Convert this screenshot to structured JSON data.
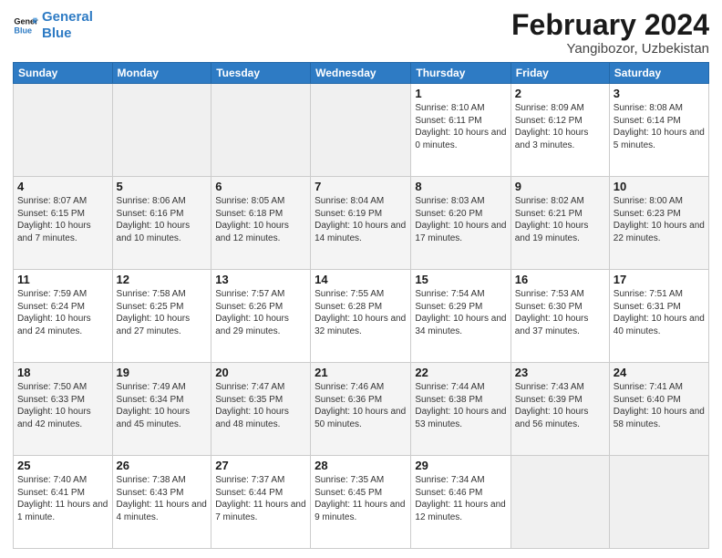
{
  "logo": {
    "line1": "General",
    "line2": "Blue"
  },
  "title": "February 2024",
  "subtitle": "Yangibozor, Uzbekistan",
  "days_header": [
    "Sunday",
    "Monday",
    "Tuesday",
    "Wednesday",
    "Thursday",
    "Friday",
    "Saturday"
  ],
  "weeks": [
    [
      {
        "day": "",
        "info": ""
      },
      {
        "day": "",
        "info": ""
      },
      {
        "day": "",
        "info": ""
      },
      {
        "day": "",
        "info": ""
      },
      {
        "day": "1",
        "info": "Sunrise: 8:10 AM\nSunset: 6:11 PM\nDaylight: 10 hours and 0 minutes."
      },
      {
        "day": "2",
        "info": "Sunrise: 8:09 AM\nSunset: 6:12 PM\nDaylight: 10 hours and 3 minutes."
      },
      {
        "day": "3",
        "info": "Sunrise: 8:08 AM\nSunset: 6:14 PM\nDaylight: 10 hours and 5 minutes."
      }
    ],
    [
      {
        "day": "4",
        "info": "Sunrise: 8:07 AM\nSunset: 6:15 PM\nDaylight: 10 hours and 7 minutes."
      },
      {
        "day": "5",
        "info": "Sunrise: 8:06 AM\nSunset: 6:16 PM\nDaylight: 10 hours and 10 minutes."
      },
      {
        "day": "6",
        "info": "Sunrise: 8:05 AM\nSunset: 6:18 PM\nDaylight: 10 hours and 12 minutes."
      },
      {
        "day": "7",
        "info": "Sunrise: 8:04 AM\nSunset: 6:19 PM\nDaylight: 10 hours and 14 minutes."
      },
      {
        "day": "8",
        "info": "Sunrise: 8:03 AM\nSunset: 6:20 PM\nDaylight: 10 hours and 17 minutes."
      },
      {
        "day": "9",
        "info": "Sunrise: 8:02 AM\nSunset: 6:21 PM\nDaylight: 10 hours and 19 minutes."
      },
      {
        "day": "10",
        "info": "Sunrise: 8:00 AM\nSunset: 6:23 PM\nDaylight: 10 hours and 22 minutes."
      }
    ],
    [
      {
        "day": "11",
        "info": "Sunrise: 7:59 AM\nSunset: 6:24 PM\nDaylight: 10 hours and 24 minutes."
      },
      {
        "day": "12",
        "info": "Sunrise: 7:58 AM\nSunset: 6:25 PM\nDaylight: 10 hours and 27 minutes."
      },
      {
        "day": "13",
        "info": "Sunrise: 7:57 AM\nSunset: 6:26 PM\nDaylight: 10 hours and 29 minutes."
      },
      {
        "day": "14",
        "info": "Sunrise: 7:55 AM\nSunset: 6:28 PM\nDaylight: 10 hours and 32 minutes."
      },
      {
        "day": "15",
        "info": "Sunrise: 7:54 AM\nSunset: 6:29 PM\nDaylight: 10 hours and 34 minutes."
      },
      {
        "day": "16",
        "info": "Sunrise: 7:53 AM\nSunset: 6:30 PM\nDaylight: 10 hours and 37 minutes."
      },
      {
        "day": "17",
        "info": "Sunrise: 7:51 AM\nSunset: 6:31 PM\nDaylight: 10 hours and 40 minutes."
      }
    ],
    [
      {
        "day": "18",
        "info": "Sunrise: 7:50 AM\nSunset: 6:33 PM\nDaylight: 10 hours and 42 minutes."
      },
      {
        "day": "19",
        "info": "Sunrise: 7:49 AM\nSunset: 6:34 PM\nDaylight: 10 hours and 45 minutes."
      },
      {
        "day": "20",
        "info": "Sunrise: 7:47 AM\nSunset: 6:35 PM\nDaylight: 10 hours and 48 minutes."
      },
      {
        "day": "21",
        "info": "Sunrise: 7:46 AM\nSunset: 6:36 PM\nDaylight: 10 hours and 50 minutes."
      },
      {
        "day": "22",
        "info": "Sunrise: 7:44 AM\nSunset: 6:38 PM\nDaylight: 10 hours and 53 minutes."
      },
      {
        "day": "23",
        "info": "Sunrise: 7:43 AM\nSunset: 6:39 PM\nDaylight: 10 hours and 56 minutes."
      },
      {
        "day": "24",
        "info": "Sunrise: 7:41 AM\nSunset: 6:40 PM\nDaylight: 10 hours and 58 minutes."
      }
    ],
    [
      {
        "day": "25",
        "info": "Sunrise: 7:40 AM\nSunset: 6:41 PM\nDaylight: 11 hours and 1 minute."
      },
      {
        "day": "26",
        "info": "Sunrise: 7:38 AM\nSunset: 6:43 PM\nDaylight: 11 hours and 4 minutes."
      },
      {
        "day": "27",
        "info": "Sunrise: 7:37 AM\nSunset: 6:44 PM\nDaylight: 11 hours and 7 minutes."
      },
      {
        "day": "28",
        "info": "Sunrise: 7:35 AM\nSunset: 6:45 PM\nDaylight: 11 hours and 9 minutes."
      },
      {
        "day": "29",
        "info": "Sunrise: 7:34 AM\nSunset: 6:46 PM\nDaylight: 11 hours and 12 minutes."
      },
      {
        "day": "",
        "info": ""
      },
      {
        "day": "",
        "info": ""
      }
    ]
  ]
}
